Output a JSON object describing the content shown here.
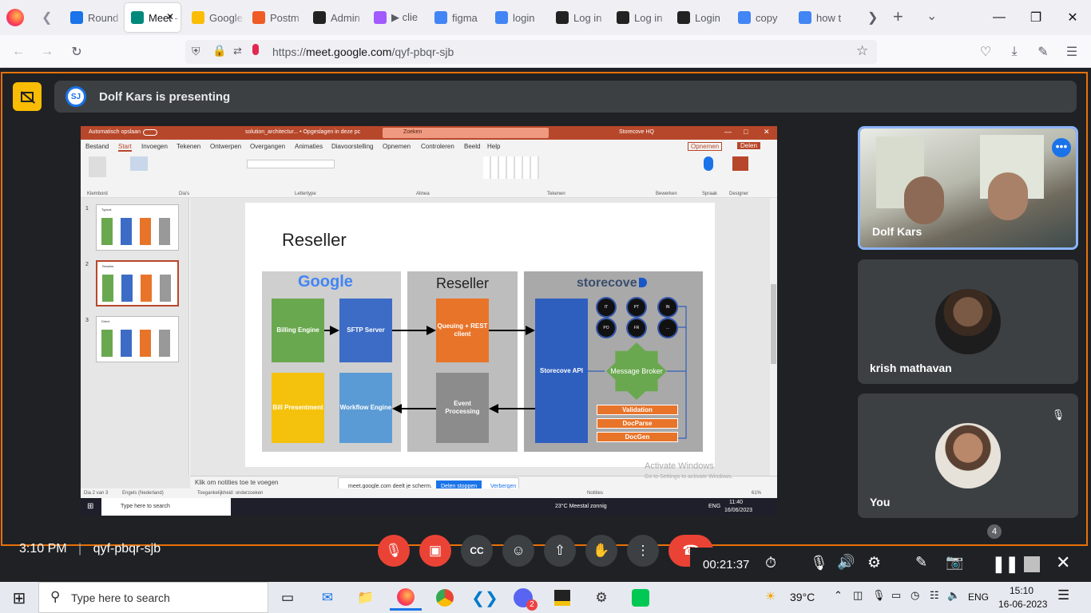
{
  "browser": {
    "tabs": [
      {
        "label": "Round",
        "color": "#1a73e8"
      },
      {
        "label": "Meet - PLA",
        "color": "#00897b",
        "active": true
      },
      {
        "label": "Google",
        "color": "#fbbc04"
      },
      {
        "label": "Postm",
        "color": "#ef5b25"
      },
      {
        "label": "Admin",
        "color": "#222222"
      },
      {
        "label": "▶ clie",
        "color": "#a259ff"
      },
      {
        "label": "figma",
        "color": "#4285f4"
      },
      {
        "label": "login",
        "color": "#4285f4"
      },
      {
        "label": "Log in",
        "color": "#222222"
      },
      {
        "label": "Log in",
        "color": "#222222"
      },
      {
        "label": "Login",
        "color": "#222222"
      },
      {
        "label": "copy",
        "color": "#4285f4"
      },
      {
        "label": "how t",
        "color": "#4285f4"
      }
    ],
    "url_prefix": "https://",
    "url_host": "meet.google.com",
    "url_path": "/qyf-pbqr-sjb"
  },
  "meet": {
    "presenting_text": "Dolf Kars is presenting",
    "presenter_initials": "SJ",
    "time": "3:10 PM",
    "meeting_code": "qyf-pbqr-sjb",
    "participant_count": "4",
    "tiles": [
      {
        "name": "Dolf Kars"
      },
      {
        "name": "krish mathavan"
      },
      {
        "name": "You"
      }
    ]
  },
  "recorder": {
    "elapsed": "00:21:37"
  },
  "shared": {
    "ppt_title": "solution_architectur... • Opgeslagen in deze pc",
    "autosave": "Automatisch opslaan",
    "search": "Zoeken",
    "account": "Storecove HQ",
    "ribbon_tabs": [
      "Bestand",
      "Start",
      "Invoegen",
      "Tekenen",
      "Ontwerpen",
      "Overgangen",
      "Animaties",
      "Diavoorstelling",
      "Opnemen",
      "Controleren",
      "Beeld",
      "Help"
    ],
    "record_btn": "Opnemen",
    "share_btn": "Delen",
    "ribbon_groups": [
      "Klembord",
      "Dia's",
      "Lettertype",
      "Alinea",
      "Tekenen",
      "Bewerken",
      "Spraak",
      "Designer"
    ],
    "slide_title": "Reseller",
    "col_google": "Google",
    "col_reseller": "Reseller",
    "col_storecove": "storecove",
    "boxes": {
      "billing": "Billing Engine",
      "sftp": "SFTP Server",
      "queuing": "Queuing + REST client",
      "bill_present": "Bill Presentment",
      "workflow": "Workflow Engine",
      "event": "Event Processing",
      "api": "Storecove API",
      "broker": "Message Broker",
      "validation": "Validation",
      "docparse": "DocParse",
      "docgen": "DocGen"
    },
    "circles": [
      "IT",
      "PT",
      "IN",
      "PO",
      "FR",
      "..."
    ],
    "thumb_titles": [
      "Typical",
      "Reseller",
      "Direct"
    ],
    "notes_placeholder": "Klik om notities toe te voegen",
    "status_left": "Dia 2 van 3",
    "status_lang": "Engels (Nederland)",
    "status_access": "Toegankelijkheid: onderzoeken",
    "notes_btn": "Notities",
    "zoom": "61%",
    "sharing_msg": "meet.google.com deelt je scherm.",
    "stop_sharing": "Delen stoppen",
    "hide": "Verbergen",
    "activate_1": "Activate Windows",
    "activate_2": "Go to Settings to activate Windows.",
    "inner_search": "Type here to search",
    "inner_weather": "23°C  Meestal zonnig",
    "inner_lang": "ENG",
    "inner_time": "11:40",
    "inner_date": "16/06/2023"
  },
  "taskbar": {
    "search": "Type here to search",
    "temp": "39°C",
    "lang": "ENG",
    "time": "15:10",
    "date": "16-06-2023",
    "discord_badge": "2"
  }
}
